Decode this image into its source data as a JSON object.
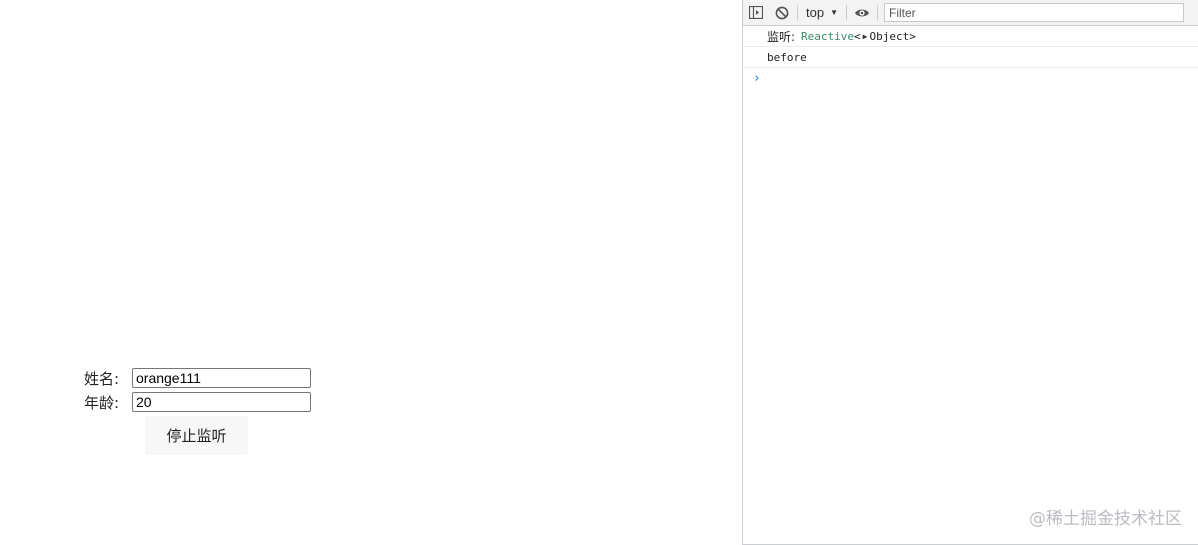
{
  "form": {
    "name_label": "姓名:",
    "name_value": "orange111",
    "age_label": "年龄:",
    "age_value": "20",
    "stop_button_label": "停止监听"
  },
  "devtools": {
    "toolbar": {
      "context_label": "top",
      "filter_placeholder": "Filter"
    },
    "console": {
      "messages": [
        {
          "key": "监听:",
          "type_name": "Reactive",
          "open_bracket": "<",
          "object_label": "Object",
          "close_bracket": ">"
        },
        {
          "text": "before"
        }
      ],
      "prompt_symbol": "›"
    }
  },
  "watermark": "@稀土掘金技术社区"
}
